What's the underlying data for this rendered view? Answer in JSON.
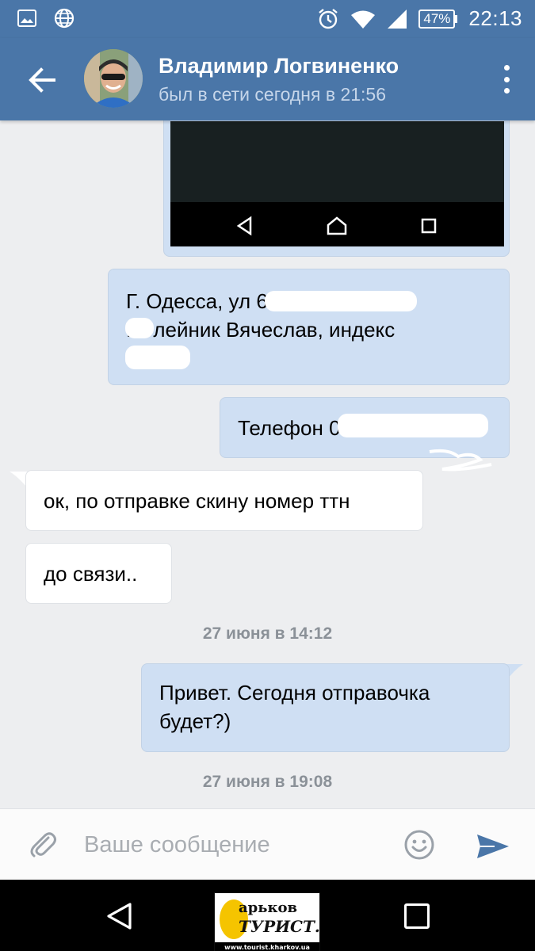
{
  "status_bar": {
    "battery": "47%",
    "time": "22:13"
  },
  "header": {
    "contact_name": "Владимир Логвиненко",
    "contact_status": "был в сети сегодня в 21:56"
  },
  "messages": [
    {
      "id": "address",
      "direction": "outgoing",
      "text": "Г. Одесса, ул                   64, кв\n   . Олейник Вячеслав, индекс"
    },
    {
      "id": "phone",
      "direction": "outgoing",
      "text": "Телефон 097              7"
    },
    {
      "id": "ok",
      "direction": "incoming",
      "text": "ок, по отправке скину номер ттн"
    },
    {
      "id": "dosvyazi",
      "direction": "incoming",
      "text": "до связи.."
    },
    {
      "id": "privet",
      "direction": "outgoing",
      "text": "Привет.  Сегодня отправочка\nбудет?)"
    }
  ],
  "date_separators": [
    "27 июня в 14:12",
    "27 июня в 19:08"
  ],
  "composer": {
    "placeholder": "Ваше сообщение"
  },
  "watermark": {
    "line1": "арьков",
    "line2": "ТУРИСТ.",
    "url": "www.tourist.kharkov.ua"
  },
  "colors": {
    "header": "#4a76a8",
    "outgoing_bubble": "#cfdff3",
    "incoming_bubble": "#ffffff",
    "background": "#edeef0",
    "send_icon": "#4a76a8"
  },
  "icons": {
    "status_left": [
      "gallery-icon",
      "globe-icon"
    ],
    "status_right": [
      "alarm-icon",
      "wifi-icon",
      "signal-icon",
      "battery-icon"
    ],
    "header": [
      "back-arrow-icon",
      "more-vert-icon"
    ],
    "composer": [
      "paperclip-icon",
      "emoji-icon",
      "send-icon"
    ],
    "navigation": [
      "nav-back-icon",
      "nav-home-icon",
      "nav-recent-icon"
    ]
  }
}
